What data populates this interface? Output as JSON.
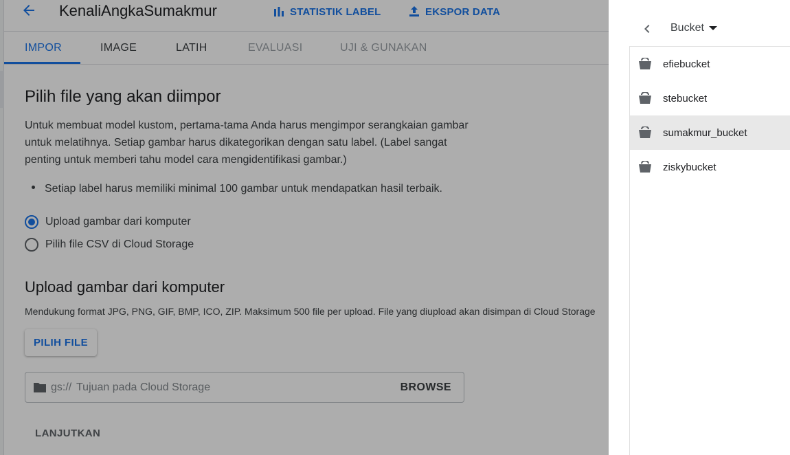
{
  "header": {
    "title": "KenaliAngkaSumakmur",
    "actions": [
      {
        "label": "STATISTIK LABEL",
        "icon": "bar-chart-icon"
      },
      {
        "label": "EKSPOR DATA",
        "icon": "upload-icon"
      }
    ]
  },
  "tabs": [
    {
      "label": "IMPOR",
      "state": "active"
    },
    {
      "label": "IMAGE",
      "state": "normal"
    },
    {
      "label": "LATIH",
      "state": "normal"
    },
    {
      "label": "EVALUASI",
      "state": "disabled"
    },
    {
      "label": "UJI & GUNAKAN",
      "state": "disabled"
    }
  ],
  "import": {
    "title": "Pilih file yang akan diimpor",
    "description": "Untuk membuat model kustom, pertama-tama Anda harus mengimpor serangkaian gambar untuk melatihnya. Setiap gambar harus dikategorikan dengan satu label. (Label sangat penting untuk memberi tahu model cara mengidentifikasi gambar.)",
    "bullet": "Setiap label harus memiliki minimal 100 gambar untuk mendapatkan hasil terbaik.",
    "options": [
      {
        "label": "Upload gambar dari komputer",
        "checked": true
      },
      {
        "label": "Pilih file CSV di Cloud Storage",
        "checked": false
      }
    ]
  },
  "upload": {
    "title": "Upload gambar dari komputer",
    "formats": "Mendukung format JPG, PNG, GIF, BMP, ICO, ZIP. Maksimum 500 file per upload. File yang diupload akan disimpan di Cloud Storage",
    "choose_button": "PILIH FILE",
    "destination_prefix": "gs://",
    "destination_placeholder": "Tujuan pada Cloud Storage",
    "browse_button": "BROWSE",
    "continue_button": "LANJUTKAN"
  },
  "bucket_panel": {
    "selector_label": "Bucket",
    "buckets": [
      {
        "name": "efiebucket",
        "selected": false
      },
      {
        "name": "stebucket",
        "selected": false
      },
      {
        "name": "sumakmur_bucket",
        "selected": true
      },
      {
        "name": "ziskybucket",
        "selected": false
      }
    ]
  },
  "colors": {
    "accent": "#1a73e8",
    "scrim": "rgba(0,0,0,0.32)",
    "selected_row": "#e8e8e8"
  }
}
